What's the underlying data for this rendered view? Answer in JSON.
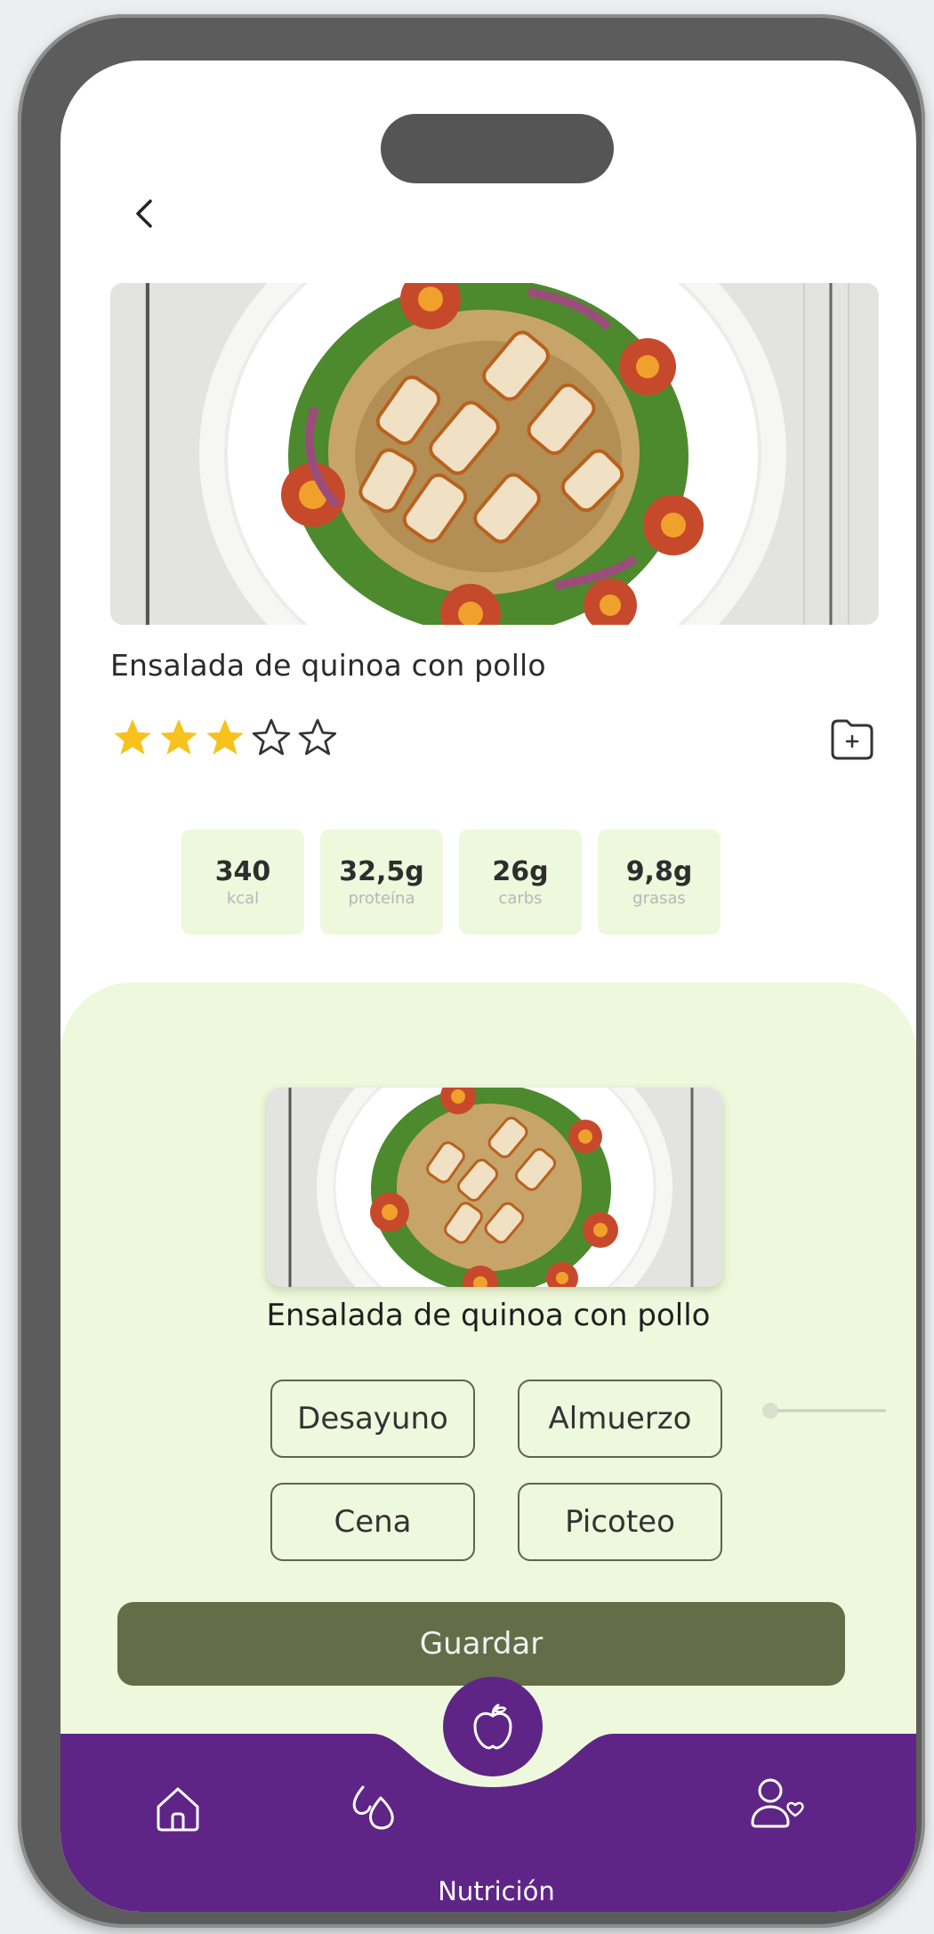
{
  "recipe": {
    "title": "Ensalada de quinoa con pollo",
    "rating": 3,
    "max_rating": 5,
    "macros": [
      {
        "value": "340",
        "label": "kcal"
      },
      {
        "value": "32,5g",
        "label": "proteína"
      },
      {
        "value": "26g",
        "label": "carbs"
      },
      {
        "value": "9,8g",
        "label": "grasas"
      }
    ]
  },
  "sheet": {
    "title": "Ensalada de quinoa con pollo",
    "meal_options": [
      "Desayuno",
      "Almuerzo",
      "Cena",
      "Picoteo"
    ],
    "save_label": "Guardar"
  },
  "nav": {
    "items": [
      {
        "icon": "home-icon"
      },
      {
        "icon": "water-drops-icon"
      },
      {
        "icon": "apple-icon",
        "label": "Nutrición",
        "active": true
      },
      {
        "icon": "community-icon"
      }
    ]
  },
  "colors": {
    "nav_purple": "#5e2587",
    "sheet_green": "#eef8dc",
    "save_button": "#636d47",
    "star_yellow": "#f7c21e"
  }
}
